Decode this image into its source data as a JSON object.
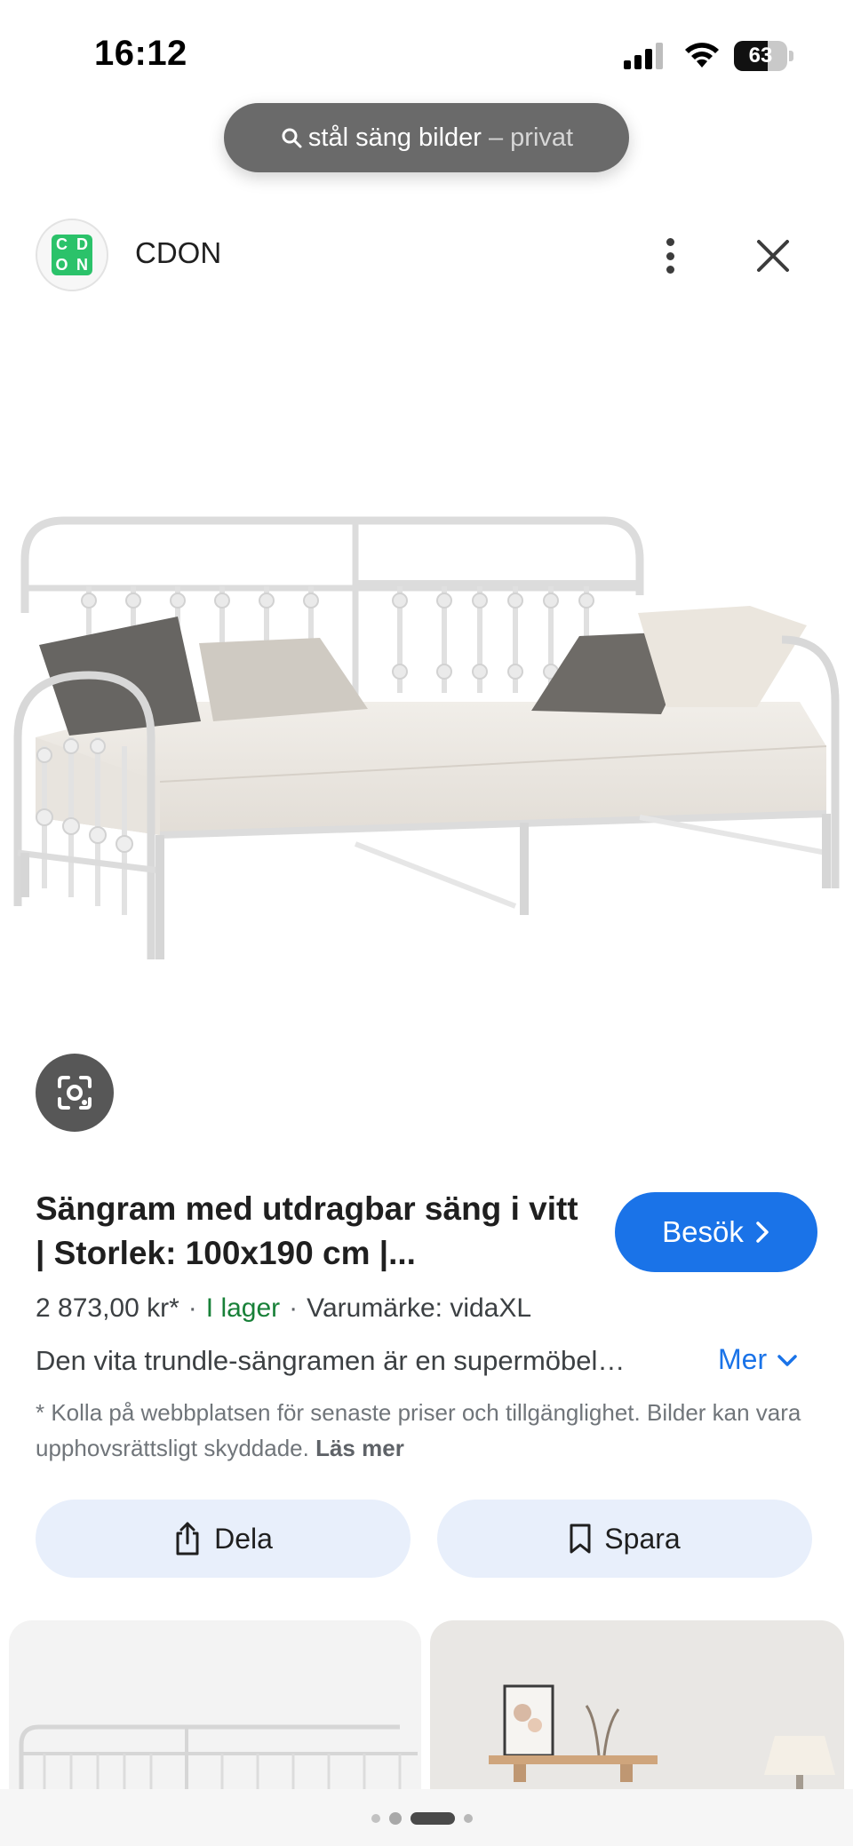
{
  "status_bar": {
    "time": "16:12",
    "battery": "63",
    "battery_level": 0.63
  },
  "search": {
    "query": "stål säng bilder",
    "mode": "– privat"
  },
  "source": {
    "name": "CDON",
    "logo_letters": [
      "C",
      "D",
      "O",
      "N"
    ]
  },
  "product": {
    "title": "Sängram med utdragbar säng i vitt | Storlek: 100x190 cm |...",
    "price": "2 873,00 kr*",
    "stock": "I lager",
    "brand": "Varumärke: vidaXL",
    "description": "Den vita trundle-sängramen är en supermöbel…",
    "more_label": "Mer",
    "visit_label": "Besök",
    "disclaimer": "* Kolla på webbplatsen för senaste priser och tillgänglighet. Bilder kan vara upphovsrättsligt skyddade.",
    "read_more": "Läs mer"
  },
  "actions": {
    "share_label": "Dela",
    "save_label": "Spara"
  },
  "colors": {
    "accent": "#1a73e8",
    "stock_green": "#188038",
    "logo_green": "#2bc26a",
    "action_bg": "#e8effb"
  }
}
